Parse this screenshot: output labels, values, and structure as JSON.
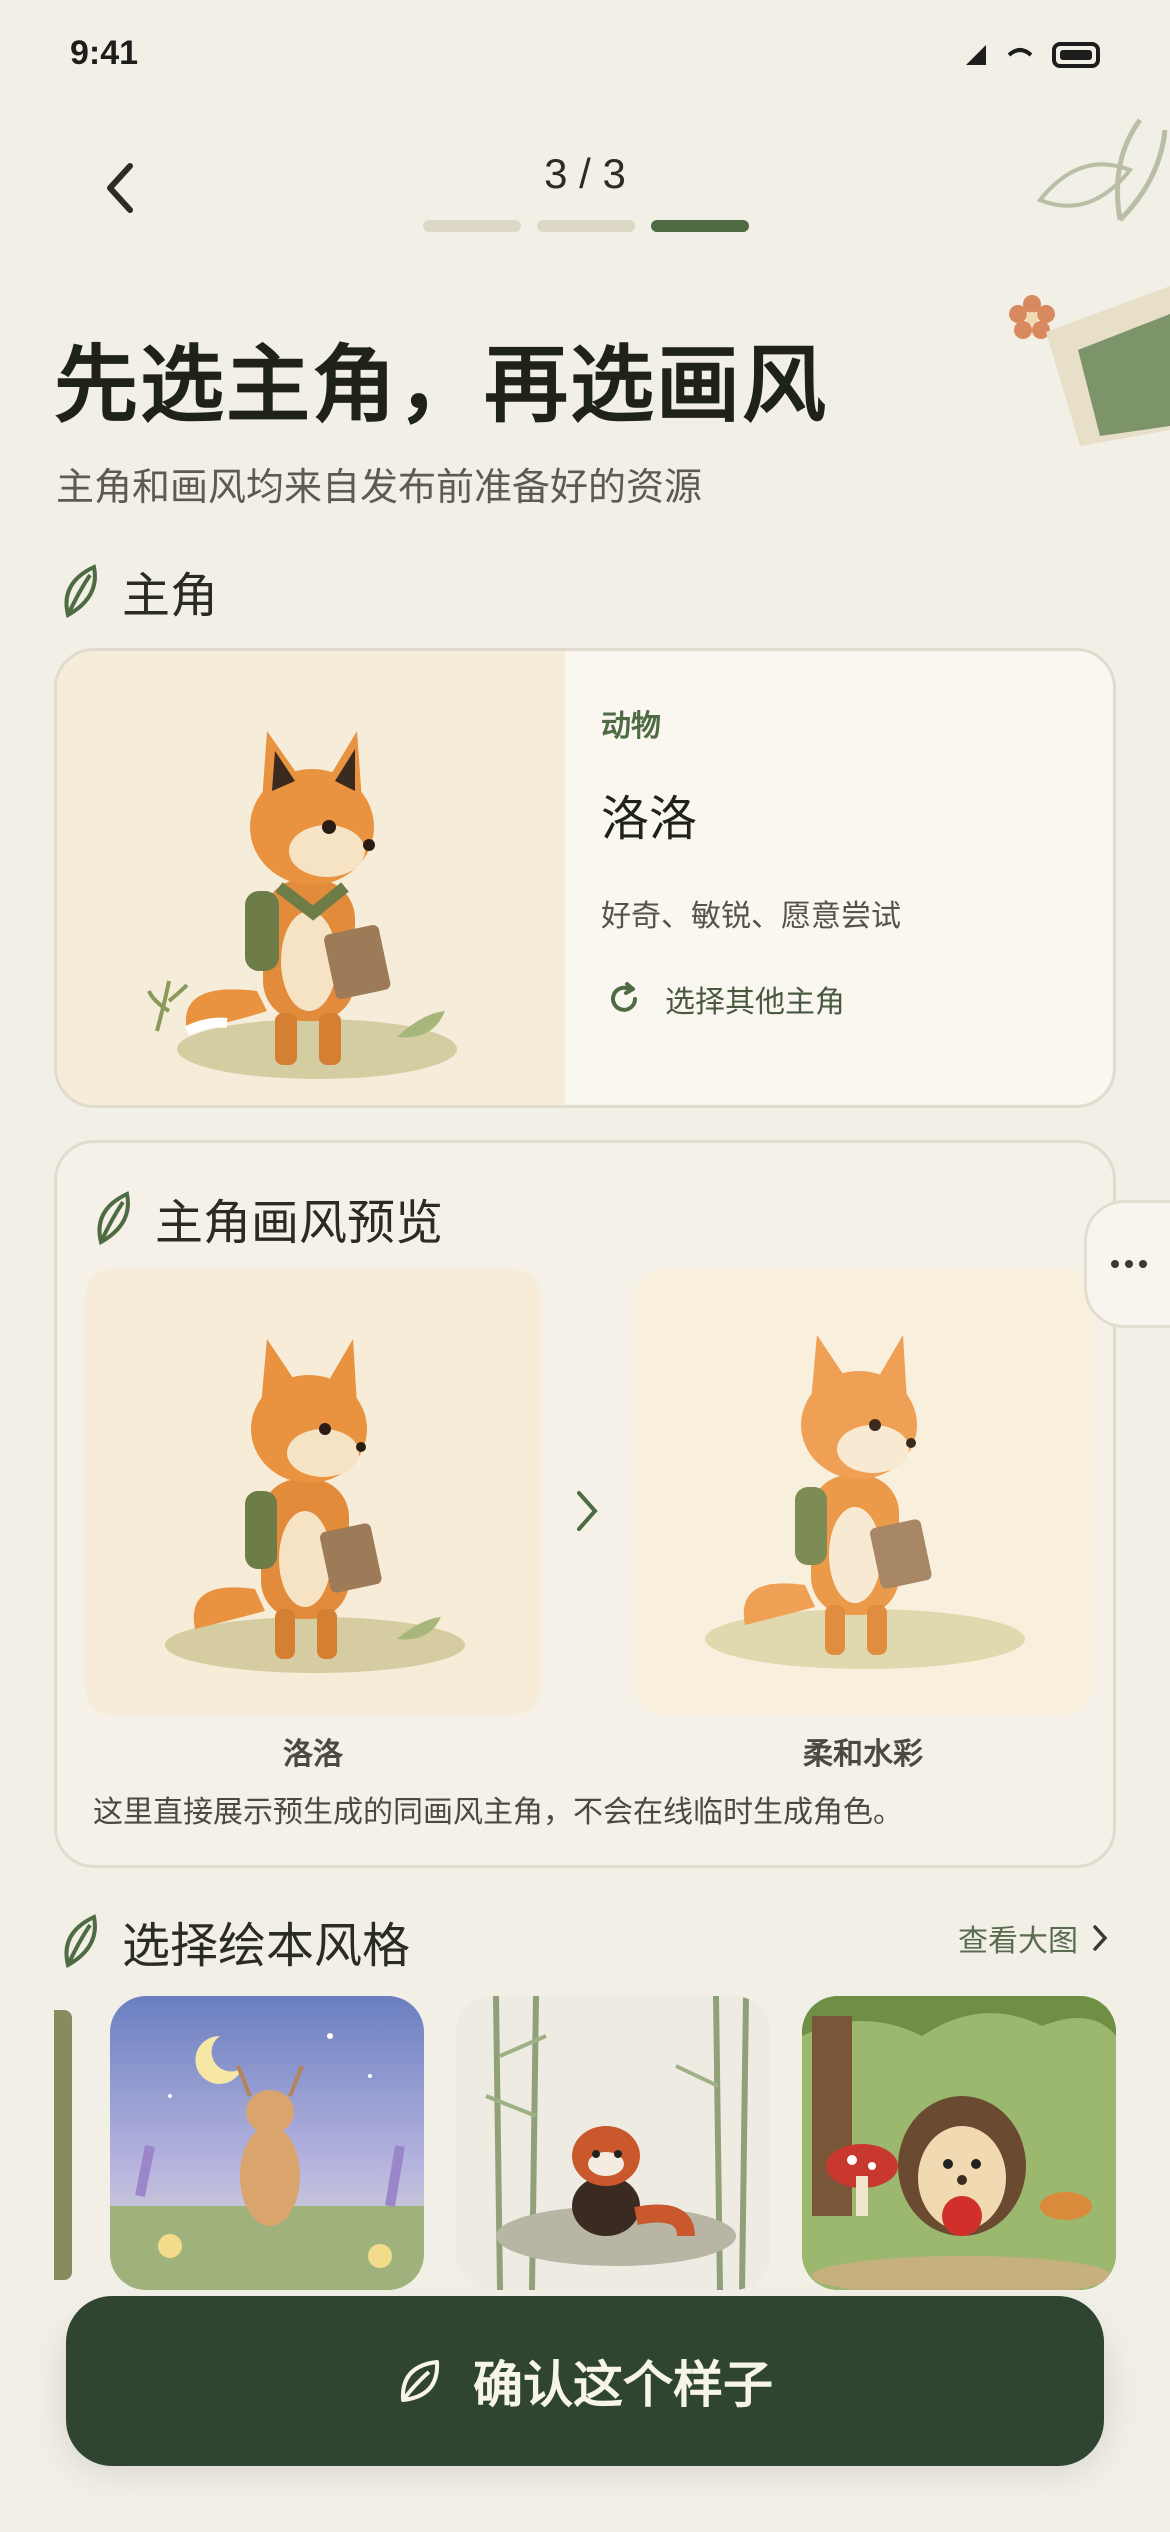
{
  "status": {
    "time": "9:41"
  },
  "header": {
    "step": "3 / 3",
    "title": "先选主角，再选画风",
    "subtitle": "主角和画风均来自发布前准备好的资源"
  },
  "protagonist": {
    "section_title": "主角",
    "category": "动物",
    "name": "洛洛",
    "traits": "好奇、敏锐、愿意尝试",
    "change_label": "选择其他主角"
  },
  "preview": {
    "section_title": "主角画风预览",
    "left_label": "洛洛",
    "right_label": "柔和水彩",
    "note": "这里直接展示预生成的同画风主角，不会在线临时生成角色。"
  },
  "styles": {
    "section_title": "选择绘本风格",
    "view_large_label": "查看大图",
    "items": [
      {
        "icon": "deer-night-meadow-illustration"
      },
      {
        "icon": "red-panda-bamboo-ink-illustration"
      },
      {
        "icon": "hedgehog-mushroom-clay-illustration"
      }
    ]
  },
  "cta": {
    "label": "确认这个样子"
  },
  "colors": {
    "accent": "#4f6b43",
    "cta_bg": "#2f4532",
    "background": "#f2efe6"
  }
}
